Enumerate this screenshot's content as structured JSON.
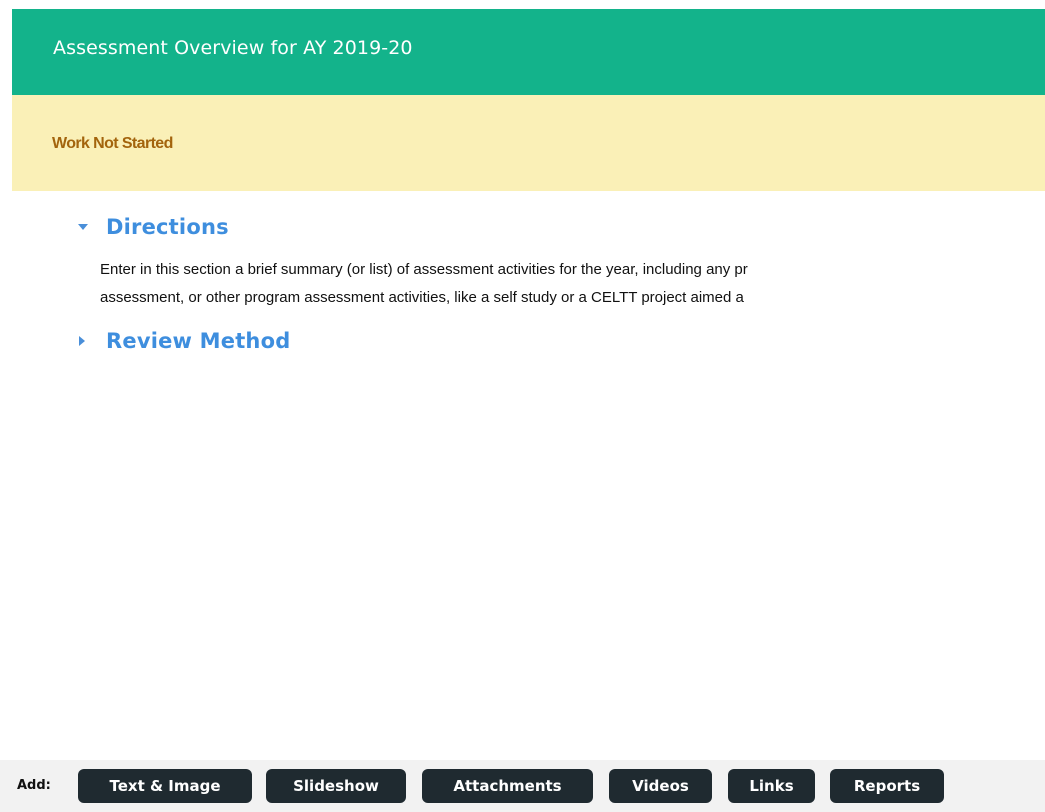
{
  "header": {
    "title": "Assessment Overview for AY 2019-20",
    "color": "#13b38b"
  },
  "status": {
    "text": "Work Not Started",
    "background": "#faf0b7",
    "color": "#a3640c"
  },
  "sections": [
    {
      "label": "Directions",
      "expanded": true,
      "icon": "caret-down-icon",
      "body_lines": [
        "Enter in this section a brief summary (or list) of assessment activities for the year, including any pr",
        "assessment, or other program assessment activities, like a self study or a CELTT project aimed a"
      ]
    },
    {
      "label": "Review Method",
      "expanded": false,
      "icon": "caret-right-icon"
    }
  ],
  "toolbar": {
    "label": "Add:",
    "buttons": [
      "Text & Image",
      "Slideshow",
      "Attachments",
      "Videos",
      "Links",
      "Reports"
    ]
  }
}
